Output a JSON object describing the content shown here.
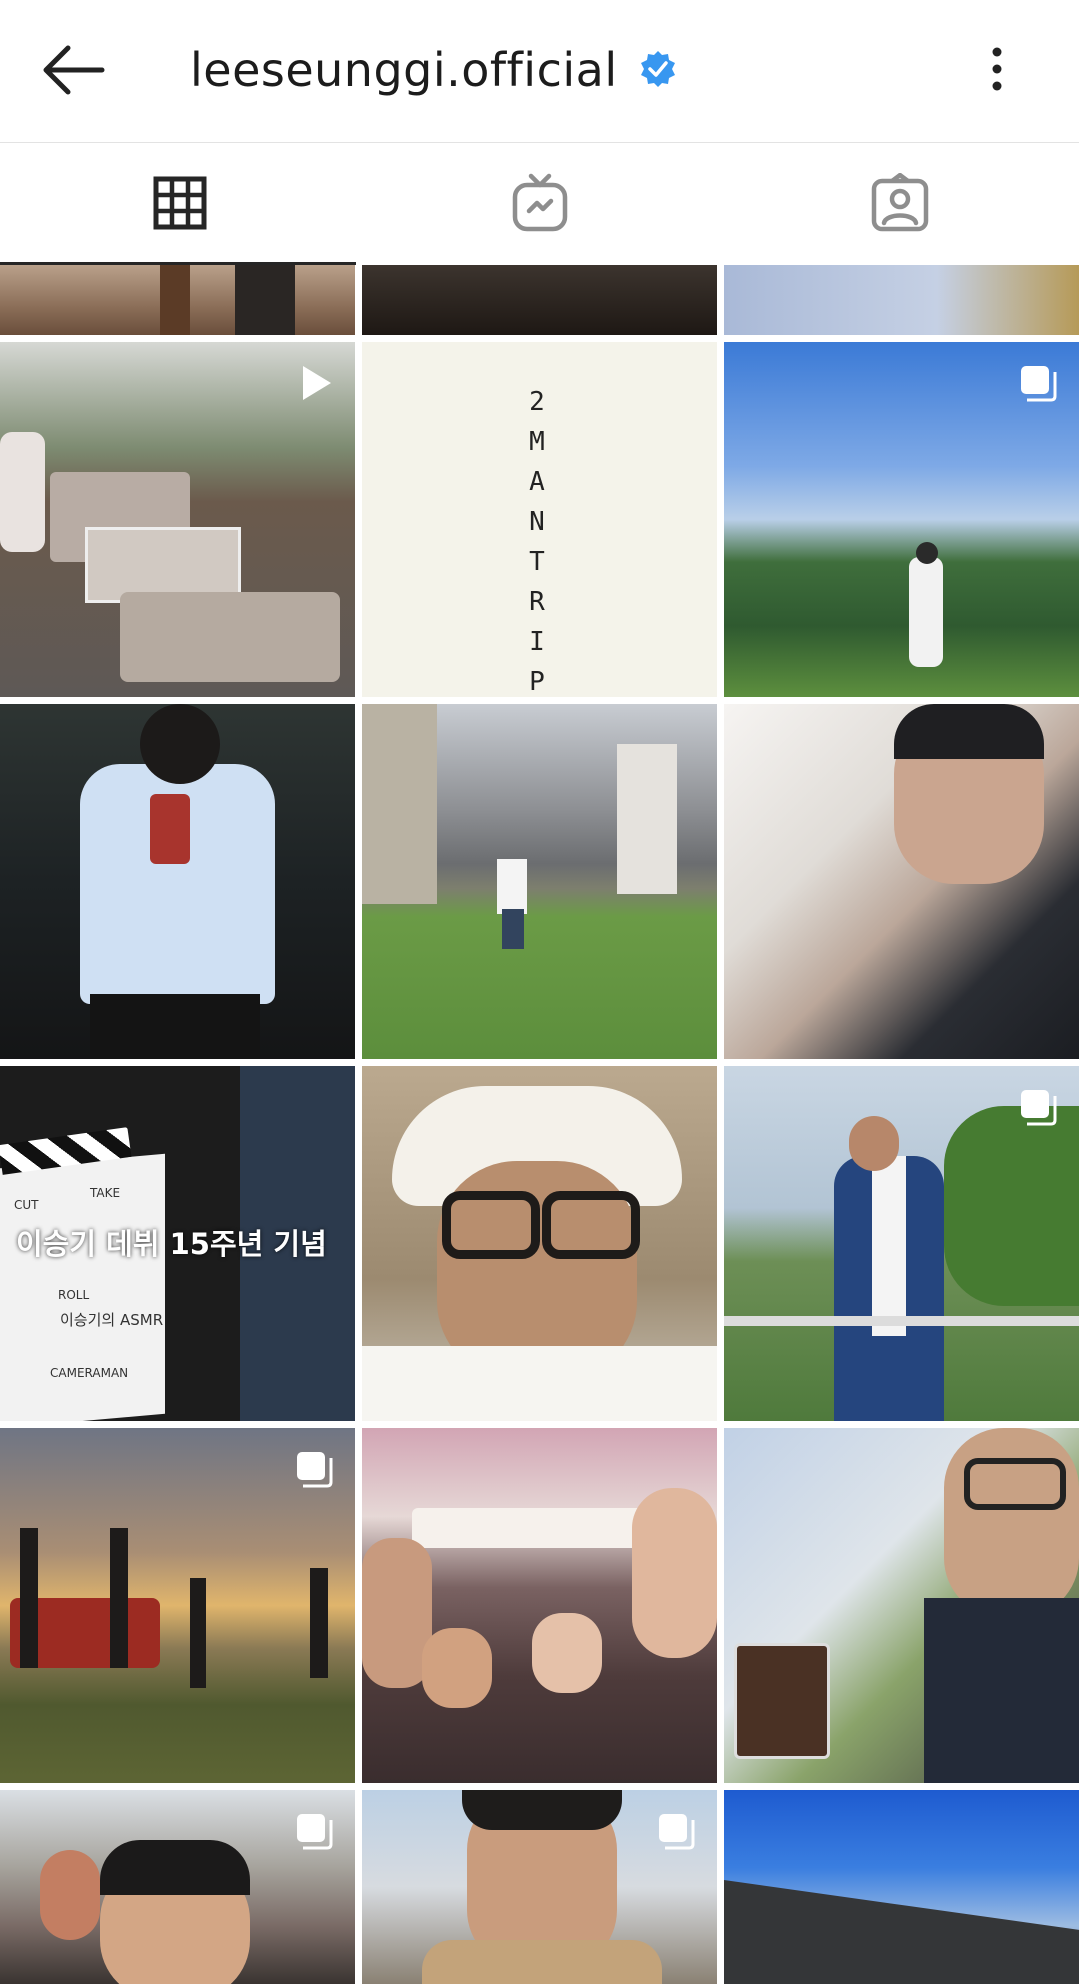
{
  "header": {
    "username": "leeseunggi.official",
    "verified_color": "#3897f0",
    "back_icon": "arrow-left-icon",
    "menu_icon": "more-vertical-icon"
  },
  "tabs": [
    {
      "name": "posts-grid",
      "icon": "grid-icon",
      "selected": true
    },
    {
      "name": "igtv",
      "icon": "tv-icon",
      "selected": false
    },
    {
      "name": "tagged",
      "icon": "person-tag-icon",
      "selected": false
    }
  ],
  "posts": {
    "trip_text": "2MANTRIP",
    "clapper_caption": "이승기 데뷔 15주년 기념",
    "clapper_cut": "CUT",
    "clapper_take": "TAKE",
    "clapper_roll": "ROLL",
    "clapper_roll_value": "이승기의 ASMR",
    "clapper_cameraman": "CAMERAMAN"
  }
}
